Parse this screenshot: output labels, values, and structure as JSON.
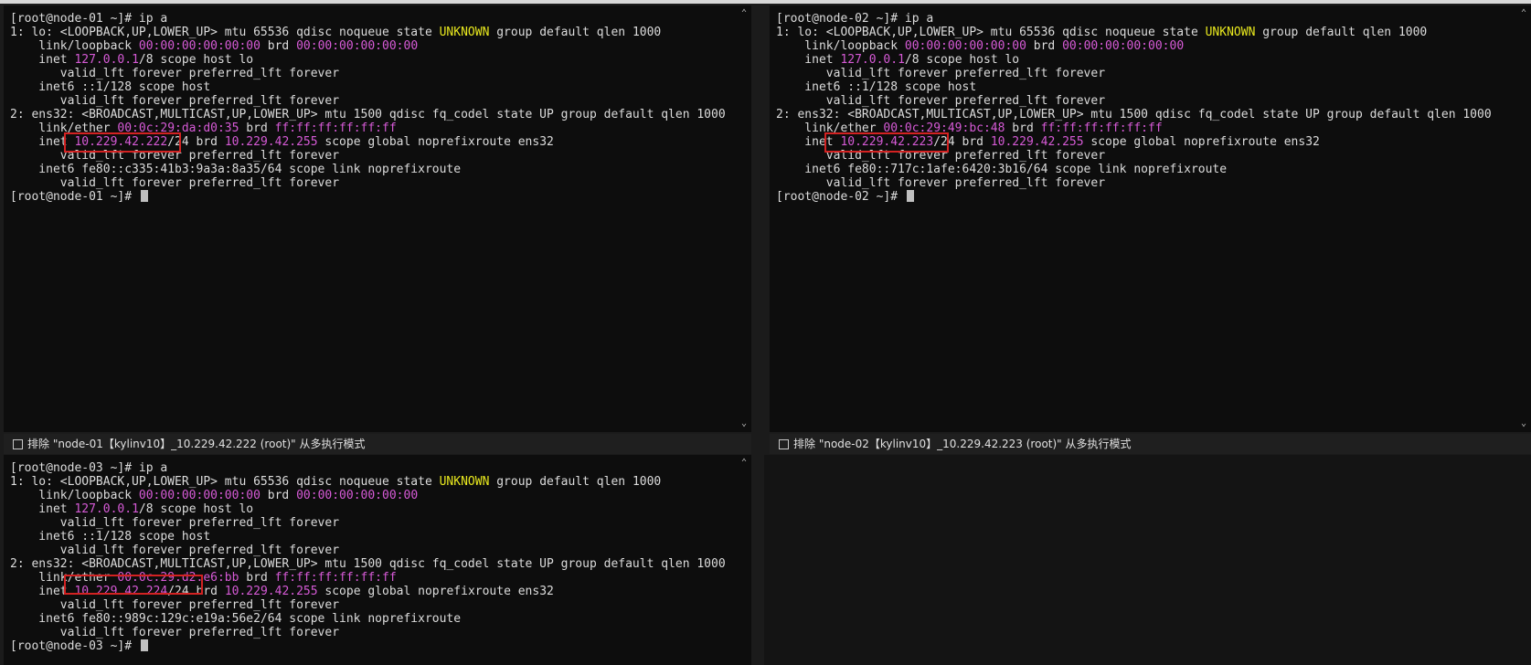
{
  "panes": [
    {
      "name": "node-01",
      "lines": [
        [
          {
            "t": "[root@node-01 ~]# ip a"
          }
        ],
        [
          {
            "t": "1: lo: <LOOPBACK,UP,LOWER_UP> mtu 65536 qdisc noqueue state "
          },
          {
            "t": "UNKNOWN",
            "c": "yel"
          },
          {
            "t": " group default qlen 1000"
          }
        ],
        [
          {
            "t": "    link/loopback "
          },
          {
            "t": "00:00:00:00:00:00",
            "c": "mag"
          },
          {
            "t": " brd "
          },
          {
            "t": "00:00:00:00:00:00",
            "c": "mag"
          }
        ],
        [
          {
            "t": "    inet "
          },
          {
            "t": "127.0.0.1",
            "c": "mag"
          },
          {
            "t": "/8 scope host lo"
          }
        ],
        [
          {
            "t": "       valid_lft forever preferred_lft forever"
          }
        ],
        [
          {
            "t": "    inet6 ::1/128 scope host"
          }
        ],
        [
          {
            "t": "       valid_lft forever preferred_lft forever"
          }
        ],
        [
          {
            "t": "2: ens32: <BROADCAST,MULTICAST,UP,LOWER_UP> mtu 1500 qdisc fq_codel state UP group default qlen 1000"
          }
        ],
        [
          {
            "t": "    link/ether "
          },
          {
            "t": "00:0c:29:da:d0:35",
            "c": "mag"
          },
          {
            "t": " brd "
          },
          {
            "t": "ff:ff:ff:ff:ff:ff",
            "c": "mag"
          }
        ],
        [
          {
            "t": "    inet "
          },
          {
            "t": "10.229.42.222",
            "c": "mag"
          },
          {
            "t": "/24 brd "
          },
          {
            "t": "10.229.42.255",
            "c": "mag"
          },
          {
            "t": " scope global noprefixroute ens32"
          }
        ],
        [
          {
            "t": "       valid_lft forever preferred_lft forever"
          }
        ],
        [
          {
            "t": "    inet6 fe80::c335:41b3:9a3a:8a35/64 scope link noprefixroute"
          }
        ],
        [
          {
            "t": "       valid_lft forever preferred_lft forever"
          }
        ],
        [
          {
            "t": "[root@node-01 ~]# "
          }
        ]
      ],
      "status": "排除 \"node-01【kylinv10】_10.229.42.222 (root)\" 从多执行模式"
    },
    {
      "name": "node-02",
      "lines": [
        [
          {
            "t": "[root@node-02 ~]# ip a"
          }
        ],
        [
          {
            "t": "1: lo: <LOOPBACK,UP,LOWER_UP> mtu 65536 qdisc noqueue state "
          },
          {
            "t": "UNKNOWN",
            "c": "yel"
          },
          {
            "t": " group default qlen 1000"
          }
        ],
        [
          {
            "t": "    link/loopback "
          },
          {
            "t": "00:00:00:00:00:00",
            "c": "mag"
          },
          {
            "t": " brd "
          },
          {
            "t": "00:00:00:00:00:00",
            "c": "mag"
          }
        ],
        [
          {
            "t": "    inet "
          },
          {
            "t": "127.0.0.1",
            "c": "mag"
          },
          {
            "t": "/8 scope host lo"
          }
        ],
        [
          {
            "t": "       valid_lft forever preferred_lft forever"
          }
        ],
        [
          {
            "t": "    inet6 ::1/128 scope host"
          }
        ],
        [
          {
            "t": "       valid_lft forever preferred_lft forever"
          }
        ],
        [
          {
            "t": "2: ens32: <BROADCAST,MULTICAST,UP,LOWER_UP> mtu 1500 qdisc fq_codel state UP group default qlen 1000"
          }
        ],
        [
          {
            "t": "    link/ether "
          },
          {
            "t": "00:0c:29:49:bc:48",
            "c": "mag"
          },
          {
            "t": " brd "
          },
          {
            "t": "ff:ff:ff:ff:ff:ff",
            "c": "mag"
          }
        ],
        [
          {
            "t": "    inet "
          },
          {
            "t": "10.229.42.223",
            "c": "mag"
          },
          {
            "t": "/24 brd "
          },
          {
            "t": "10.229.42.255",
            "c": "mag"
          },
          {
            "t": " scope global noprefixroute ens32"
          }
        ],
        [
          {
            "t": "       valid_lft forever preferred_lft forever"
          }
        ],
        [
          {
            "t": "    inet6 fe80::717c:1afe:6420:3b16/64 scope link noprefixroute"
          }
        ],
        [
          {
            "t": "       valid_lft forever preferred_lft forever"
          }
        ],
        [
          {
            "t": "[root@node-02 ~]# "
          }
        ]
      ],
      "status": "排除 \"node-02【kylinv10】_10.229.42.223 (root)\" 从多执行模式"
    },
    {
      "name": "node-03",
      "lines": [
        [
          {
            "t": "[root@node-03 ~]# ip a"
          }
        ],
        [
          {
            "t": "1: lo: <LOOPBACK,UP,LOWER_UP> mtu 65536 qdisc noqueue state "
          },
          {
            "t": "UNKNOWN",
            "c": "yel"
          },
          {
            "t": " group default qlen 1000"
          }
        ],
        [
          {
            "t": "    link/loopback "
          },
          {
            "t": "00:00:00:00:00:00",
            "c": "mag"
          },
          {
            "t": " brd "
          },
          {
            "t": "00:00:00:00:00:00",
            "c": "mag"
          }
        ],
        [
          {
            "t": "    inet "
          },
          {
            "t": "127.0.0.1",
            "c": "mag"
          },
          {
            "t": "/8 scope host lo"
          }
        ],
        [
          {
            "t": "       valid_lft forever preferred_lft forever"
          }
        ],
        [
          {
            "t": "    inet6 ::1/128 scope host"
          }
        ],
        [
          {
            "t": "       valid_lft forever preferred_lft forever"
          }
        ],
        [
          {
            "t": "2: ens32: <BROADCAST,MULTICAST,UP,LOWER_UP> mtu 1500 qdisc fq_codel state UP group default qlen 1000"
          }
        ],
        [
          {
            "t": "    link/ether "
          },
          {
            "t": "00:0c:29:d2:e6:bb",
            "c": "mag"
          },
          {
            "t": " brd "
          },
          {
            "t": "ff:ff:ff:ff:ff:ff",
            "c": "mag"
          }
        ],
        [
          {
            "t": "    inet "
          },
          {
            "t": "10.229.42.224",
            "c": "mag"
          },
          {
            "t": "/24 brd "
          },
          {
            "t": "10.229.42.255",
            "c": "mag"
          },
          {
            "t": " scope global noprefixroute ens32"
          }
        ],
        [
          {
            "t": "       valid_lft forever preferred_lft forever"
          }
        ],
        [
          {
            "t": "    inet6 fe80::989c:129c:e19a:56e2/64 scope link noprefixroute"
          }
        ],
        [
          {
            "t": "       valid_lft forever preferred_lft forever"
          }
        ],
        [
          {
            "t": "[root@node-03 ~]# "
          }
        ]
      ]
    }
  ],
  "colors": {
    "magenta": "#d65ad6",
    "yellow": "#e8e81e",
    "highlight_box": "#d32222"
  }
}
